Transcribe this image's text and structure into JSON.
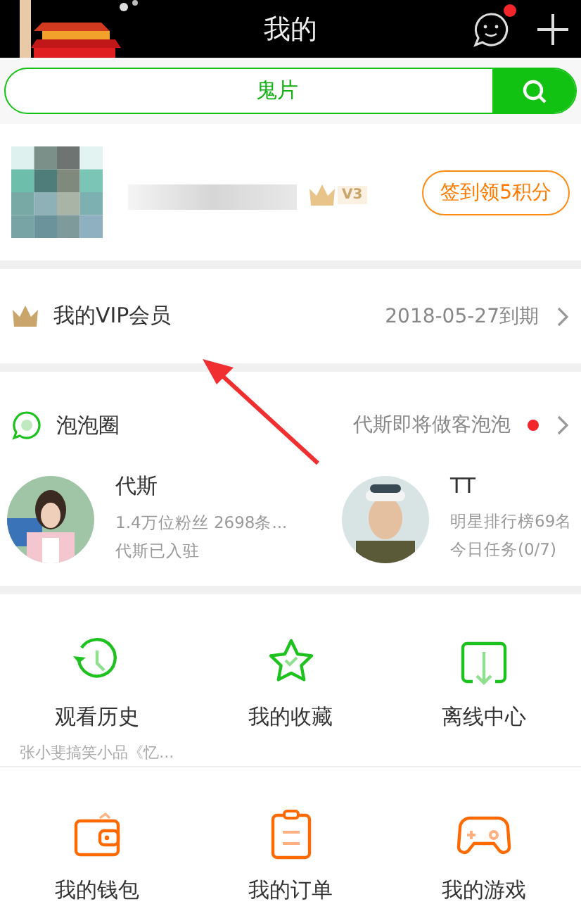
{
  "header": {
    "title": "我的",
    "message_unread": true
  },
  "search": {
    "value": "鬼片"
  },
  "profile": {
    "level_badge": "V3",
    "checkin_button": "签到领5积分"
  },
  "vip": {
    "label": "我的VIP会员",
    "expiry": "2018-05-27到期"
  },
  "bubble": {
    "title": "泡泡圈",
    "notice": "代斯即将做客泡泡",
    "unread": true,
    "stars": [
      {
        "name": "代斯",
        "line_1": "1.4万位粉丝 2698条...",
        "line_2": "代斯已入驻"
      },
      {
        "name": "TT",
        "line_1": "明星排行榜69名",
        "line_2": "今日任务(0/7)"
      }
    ]
  },
  "features": [
    [
      {
        "kind": "history",
        "label": "观看历史",
        "sub": "张小斐搞笑小品《忆..."
      },
      {
        "kind": "favorite",
        "label": "我的收藏"
      },
      {
        "kind": "offline",
        "label": "离线中心"
      }
    ],
    [
      {
        "kind": "wallet",
        "label": "我的钱包"
      },
      {
        "kind": "orders",
        "label": "我的订单"
      },
      {
        "kind": "games",
        "label": "我的游戏"
      }
    ]
  ]
}
